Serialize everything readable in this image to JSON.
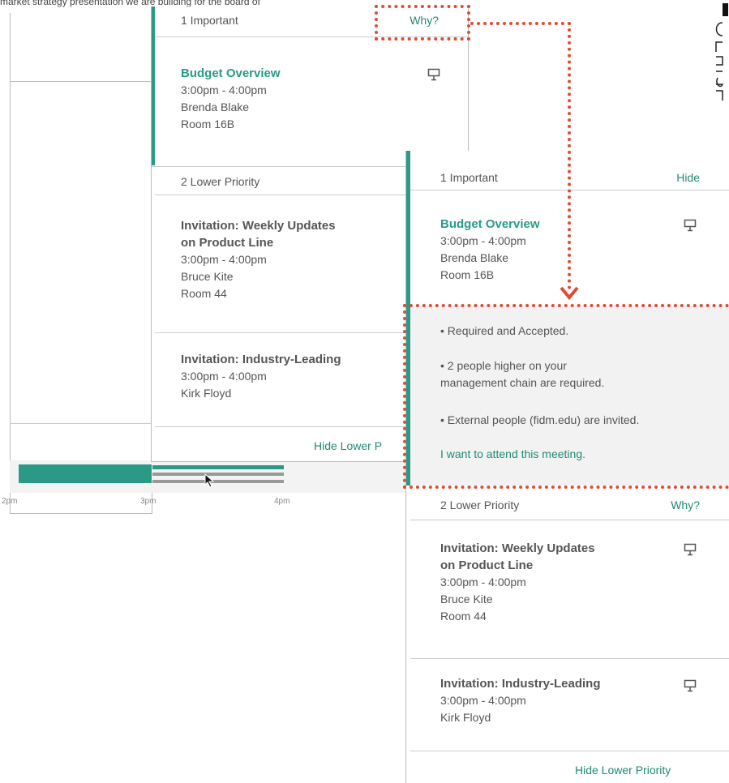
{
  "back": {
    "intro_text": "market strategy presentation we are building for the board of",
    "important_header": "1 Important",
    "important_action": "Why?",
    "important_item": {
      "title": "Budget Overview",
      "time": "3:00pm - 4:00pm",
      "person": "Brenda Blake",
      "room": "Room 16B"
    },
    "lower_header": "2 Lower Priority",
    "lower_items": [
      {
        "title_1": "Invitation: Weekly Updates",
        "title_2": "on Product Line",
        "time": "3:00pm - 4:00pm",
        "person": "Bruce Kite",
        "room": "Room 44"
      },
      {
        "title_1": "Invitation: Industry-Leading",
        "time": "3:00pm - 4:00pm",
        "person": "Kirk Floyd"
      }
    ],
    "footer_link": "Hide Lower P",
    "timeline_ticks": [
      "2pm",
      "3pm",
      "4pm"
    ]
  },
  "front": {
    "important_header": "1 Important",
    "important_action": "Hide",
    "important_item": {
      "title": "Budget Overview",
      "time": "3:00pm - 4:00pm",
      "person": "Brenda Blake",
      "room": "Room 16B"
    },
    "why_reasons": [
      "• Required and Accepted.",
      "• 2 people higher on your",
      "management chain are required.",
      "• External people (fidm.edu) are invited."
    ],
    "attend_link": "I want to attend this meeting.",
    "lower_header": "2 Lower Priority",
    "lower_action": "Why?",
    "lower_items": [
      {
        "title_1": "Invitation: Weekly Updates",
        "title_2": "on Product Line",
        "time": "3:00pm - 4:00pm",
        "person": "Bruce Kite",
        "room": "Room 44"
      },
      {
        "title_1": "Invitation: Industry-Leading",
        "time": "3:00pm - 4:00pm",
        "person": "Kirk Floyd"
      }
    ],
    "footer_link": "Hide Lower Priority"
  },
  "colors": {
    "accent": "#2a9a86",
    "link": "#1f8a73",
    "annotation": "#e24a33"
  },
  "icons": [
    "presentation-screen-icon",
    "mouse-pointer-icon"
  ]
}
